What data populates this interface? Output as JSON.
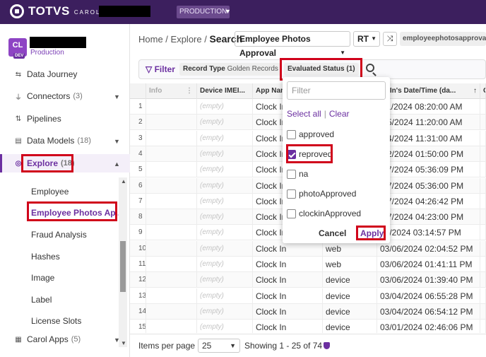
{
  "topbar": {
    "logo_text": "TOTVS",
    "logo_sub": "CAROL",
    "env_badge": "PRODUCTION"
  },
  "tenant": {
    "initials": "CL",
    "tag": "DEV",
    "env": "Production"
  },
  "sidebar": {
    "items": [
      {
        "label": "Data Journey",
        "count": ""
      },
      {
        "label": "Connectors",
        "count": "(3)"
      },
      {
        "label": "Pipelines",
        "count": ""
      },
      {
        "label": "Data Models",
        "count": "(18)"
      },
      {
        "label": "Explore",
        "count": "(18)"
      },
      {
        "label": "Carol Apps",
        "count": "(5)"
      }
    ],
    "explore_children": [
      "Employee",
      "Employee Photos Ap...",
      "Fraud Analysis",
      "Hashes",
      "Image",
      "Label",
      "License Slots"
    ]
  },
  "header": {
    "breadcrumb_home": "Home",
    "breadcrumb_explore": "Explore",
    "breadcrumb_current": "Search",
    "model": "Employee Photos Approval",
    "mode": "RT",
    "index_chip": "employeephotosapproval:"
  },
  "filterbar": {
    "filter_label": "Filter",
    "record_type_key": "Record Type",
    "record_type_value": "Golden Records",
    "status_chip": "Evaluated Status (1)"
  },
  "table": {
    "columns": [
      "Info",
      "Device IMEI...",
      "App Nam",
      "",
      "ck In's Date/Time (da..."
    ],
    "rows": [
      {
        "n": "1",
        "imei": "(empty)",
        "app": "Clock In",
        "src": "",
        "dt": "/11/2024 08:20:00 AM"
      },
      {
        "n": "2",
        "imei": "(empty)",
        "app": "Clock In",
        "src": "",
        "dt": "/05/2024 11:20:00 AM"
      },
      {
        "n": "3",
        "imei": "(empty)",
        "app": "Clock In",
        "src": "",
        "dt": "/04/2024 11:31:00 AM"
      },
      {
        "n": "4",
        "imei": "(empty)",
        "app": "Clock In",
        "src": "",
        "dt": "/02/2024 01:50:00 PM"
      },
      {
        "n": "5",
        "imei": "(empty)",
        "app": "Clock In",
        "src": "",
        "dt": "/27/2024 05:36:09 PM"
      },
      {
        "n": "6",
        "imei": "(empty)",
        "app": "Clock In",
        "src": "",
        "dt": "/27/2024 05:36:00 PM"
      },
      {
        "n": "7",
        "imei": "(empty)",
        "app": "Clock In",
        "src": "",
        "dt": "/27/2024 04:26:42 PM"
      },
      {
        "n": "8",
        "imei": "(empty)",
        "app": "Clock In",
        "src": "",
        "dt": "/27/2024 04:23:00 PM"
      },
      {
        "n": "9",
        "imei": "(empty)",
        "app": "Clock In",
        "src": "",
        "dt": "06/2024 03:14:57 PM"
      },
      {
        "n": "10",
        "imei": "(empty)",
        "app": "Clock In",
        "src": "web",
        "dt": "03/06/2024 02:04:52 PM"
      },
      {
        "n": "11",
        "imei": "(empty)",
        "app": "Clock In",
        "src": "web",
        "dt": "03/06/2024 01:41:11 PM"
      },
      {
        "n": "12",
        "imei": "(empty)",
        "app": "Clock In",
        "src": "device",
        "dt": "03/06/2024 01:39:40 PM"
      },
      {
        "n": "13",
        "imei": "(empty)",
        "app": "Clock In",
        "src": "device",
        "dt": "03/04/2024 06:55:28 PM"
      },
      {
        "n": "14",
        "imei": "(empty)",
        "app": "Clock In",
        "src": "device",
        "dt": "03/04/2024 06:54:12 PM"
      },
      {
        "n": "15",
        "imei": "(empty)",
        "app": "Clock In",
        "src": "device",
        "dt": "03/01/2024 02:46:06 PM"
      }
    ]
  },
  "dropdown": {
    "filter_placeholder": "Filter",
    "select_all": "Select all",
    "clear": "Clear",
    "options": [
      {
        "label": "approved",
        "checked": false
      },
      {
        "label": "reproved",
        "checked": true
      },
      {
        "label": "na",
        "checked": false
      },
      {
        "label": "photoApproved",
        "checked": false
      },
      {
        "label": "clockinApproved",
        "checked": false
      }
    ],
    "cancel": "Cancel",
    "apply": "Apply"
  },
  "footer": {
    "items_per_page_label": "Items per page",
    "items_per_page": "25",
    "showing": "Showing 1 - 25 of 74"
  },
  "colors": {
    "brand": "#3c1f5e",
    "accent": "#6b2fa0",
    "highlight": "#d0021b"
  }
}
